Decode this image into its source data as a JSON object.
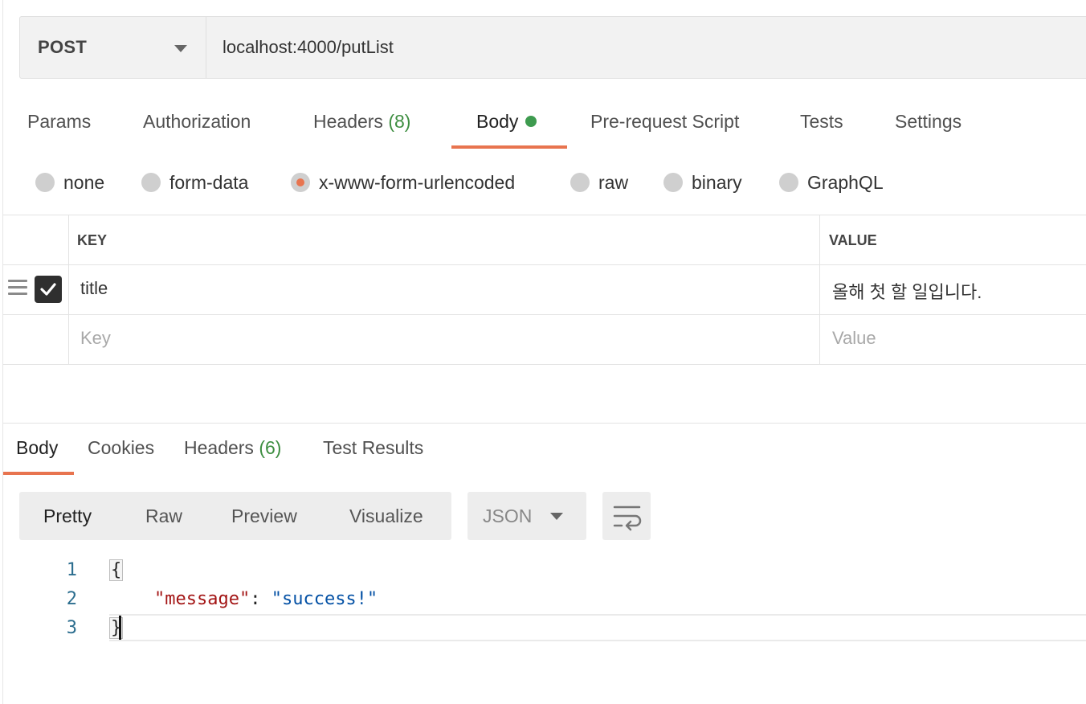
{
  "request": {
    "method": "POST",
    "url": "localhost:4000/putList"
  },
  "request_tabs": {
    "params": "Params",
    "authorization": "Authorization",
    "headers_label": "Headers",
    "headers_count": "(8)",
    "body": "Body",
    "prerequest": "Pre-request Script",
    "tests": "Tests",
    "settings": "Settings",
    "active": "Body",
    "body_indicator_color": "#3e9b4f"
  },
  "body_types": {
    "none": "none",
    "form_data": "form-data",
    "urlencoded": "x-www-form-urlencoded",
    "raw": "raw",
    "binary": "binary",
    "graphql": "GraphQL",
    "selected": "x-www-form-urlencoded"
  },
  "params_table": {
    "key_header": "KEY",
    "value_header": "VALUE",
    "rows": [
      {
        "key": "title",
        "value": "올해 첫 할 일입니다.",
        "checked": true
      }
    ],
    "key_placeholder": "Key",
    "value_placeholder": "Value"
  },
  "response_tabs": {
    "body": "Body",
    "cookies": "Cookies",
    "headers_label": "Headers",
    "headers_count": "(6)",
    "test_results": "Test Results",
    "active": "Body"
  },
  "response_view": {
    "pretty": "Pretty",
    "raw": "Raw",
    "preview": "Preview",
    "visualize": "Visualize",
    "active": "Pretty",
    "format": "JSON",
    "wrap_icon": "wrap-lines-icon"
  },
  "response_body": {
    "line_numbers": [
      "1",
      "2",
      "3"
    ],
    "open_brace": "{",
    "key": "\"message\"",
    "colon": ": ",
    "value": "\"success!\"",
    "close_brace": "}"
  },
  "colors": {
    "accent": "#e8744f",
    "count_green": "#3e8e41",
    "json_key": "#a31515",
    "json_string": "#0451a5"
  }
}
